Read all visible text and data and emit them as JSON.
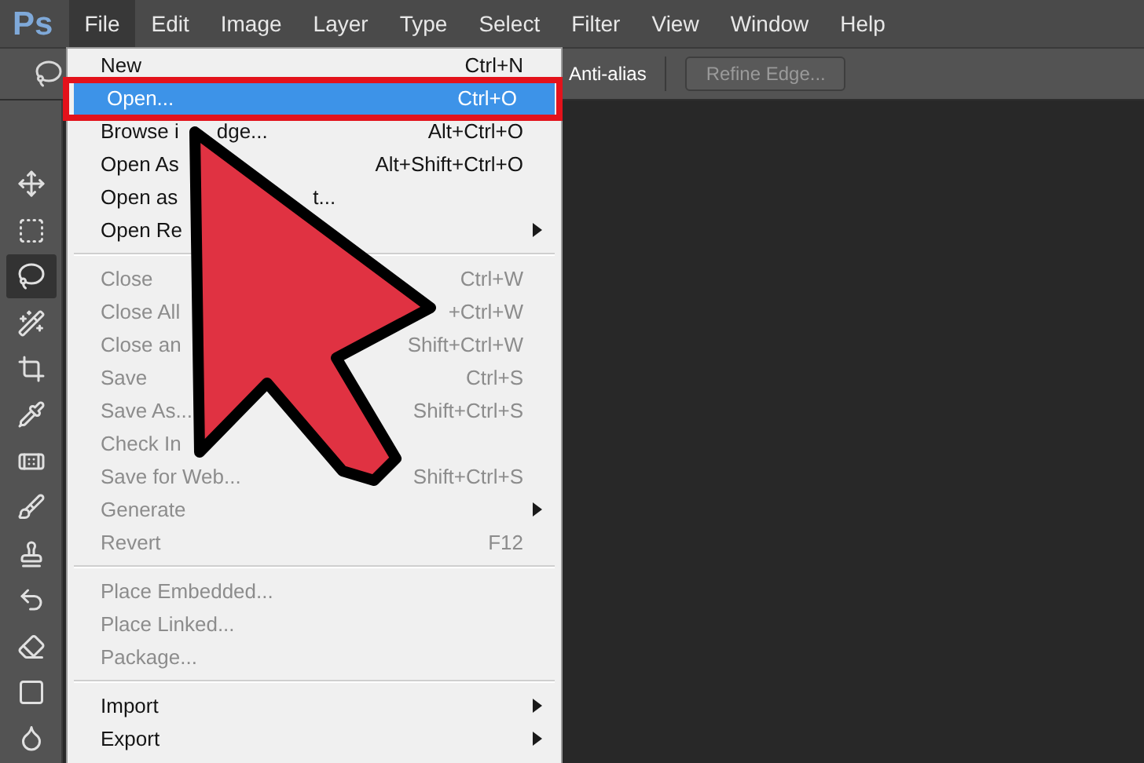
{
  "logo": "Ps",
  "menubar": [
    {
      "label": "File",
      "selected": true
    },
    {
      "label": "Edit",
      "selected": false
    },
    {
      "label": "Image",
      "selected": false
    },
    {
      "label": "Layer",
      "selected": false
    },
    {
      "label": "Type",
      "selected": false
    },
    {
      "label": "Select",
      "selected": false
    },
    {
      "label": "Filter",
      "selected": false
    },
    {
      "label": "View",
      "selected": false
    },
    {
      "label": "Window",
      "selected": false
    },
    {
      "label": "Help",
      "selected": false
    }
  ],
  "options_bar": {
    "anti_alias": "Anti-alias",
    "refine_edge": {
      "label": "Refine Edge...",
      "disabled": true
    }
  },
  "tools": [
    {
      "selected": false
    },
    {
      "selected": false
    },
    {
      "selected": true
    },
    {
      "selected": false
    },
    {
      "selected": false
    },
    {
      "selected": false
    },
    {
      "selected": false
    },
    {
      "selected": false
    },
    {
      "selected": false
    },
    {
      "selected": false
    },
    {
      "selected": false
    },
    {
      "selected": false
    },
    {
      "selected": false
    }
  ],
  "file_menu": [
    {
      "kind": "item",
      "label": "New",
      "shortcut": "Ctrl+N",
      "disabled": false,
      "selected": false
    },
    {
      "kind": "item",
      "label": "Open...",
      "shortcut": "Ctrl+O",
      "disabled": false,
      "selected": true
    },
    {
      "kind": "item",
      "label": "Browse i",
      "tail": "dge...",
      "shortcut": "Alt+Ctrl+O",
      "disabled": false,
      "selected": false
    },
    {
      "kind": "item",
      "label": "Open As",
      "shortcut": "Alt+Shift+Ctrl+O",
      "disabled": false,
      "selected": false
    },
    {
      "kind": "item",
      "label": "Open as",
      "tail": "t...",
      "disabled": false,
      "selected": false
    },
    {
      "kind": "item",
      "label": "Open Re",
      "submenu": true,
      "disabled": false,
      "selected": false
    },
    {
      "kind": "separator"
    },
    {
      "kind": "item",
      "label": "Close",
      "shortcut": "Ctrl+W",
      "disabled": true,
      "selected": false
    },
    {
      "kind": "item",
      "label": "Close All",
      "shortcut": "+Ctrl+W",
      "disabled": true,
      "selected": false
    },
    {
      "kind": "item",
      "label": "Close an",
      "shortcut": "Shift+Ctrl+W",
      "disabled": true,
      "selected": false
    },
    {
      "kind": "item",
      "label": "Save",
      "shortcut": "Ctrl+S",
      "disabled": true,
      "selected": false
    },
    {
      "kind": "item",
      "label": "Save As...",
      "shortcut": "Shift+Ctrl+S",
      "disabled": true,
      "selected": false
    },
    {
      "kind": "item",
      "label": "Check In",
      "disabled": true,
      "selected": false
    },
    {
      "kind": "item",
      "label": "Save for Web...",
      "shortcut": "Shift+Ctrl+S",
      "disabled": true,
      "selected": false
    },
    {
      "kind": "item",
      "label": "Generate",
      "submenu": true,
      "disabled": true,
      "selected": false
    },
    {
      "kind": "item",
      "label": "Revert",
      "shortcut": "F12",
      "disabled": true,
      "selected": false
    },
    {
      "kind": "separator"
    },
    {
      "kind": "item",
      "label": "Place Embedded...",
      "disabled": true,
      "selected": false
    },
    {
      "kind": "item",
      "label": "Place Linked...",
      "disabled": true,
      "selected": false
    },
    {
      "kind": "item",
      "label": "Package...",
      "disabled": true,
      "selected": false
    },
    {
      "kind": "separator"
    },
    {
      "kind": "item",
      "label": "Import",
      "submenu": true,
      "disabled": false,
      "selected": false
    },
    {
      "kind": "item",
      "label": "Export",
      "submenu": true,
      "disabled": false,
      "selected": false
    }
  ]
}
